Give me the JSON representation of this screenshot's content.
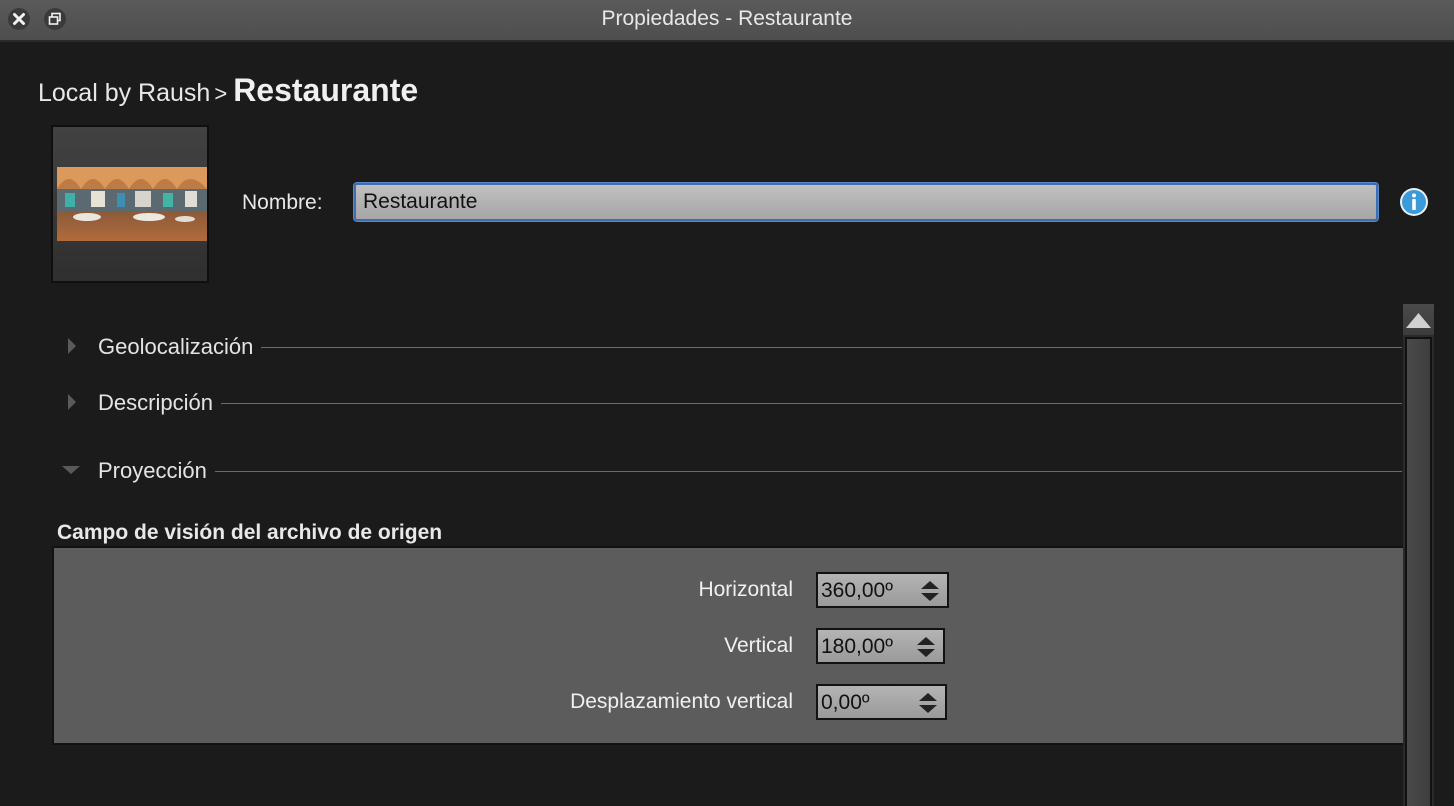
{
  "window": {
    "title": "Propiedades - Restaurante",
    "close_icon": "close-icon",
    "restore_icon": "restore-window-icon"
  },
  "breadcrumb": {
    "parent": "Local by Raush",
    "separator": ">",
    "current": "Restaurante"
  },
  "thumbnail": {
    "description_icon": "panorama-thumbnail"
  },
  "name": {
    "label": "Nombre:",
    "value": "Restaurante",
    "info_icon": "info-icon"
  },
  "sections": [
    {
      "label": "Geolocalización",
      "expanded": false
    },
    {
      "label": "Descripción",
      "expanded": false
    },
    {
      "label": "Proyección",
      "expanded": true
    }
  ],
  "fov": {
    "heading": "Campo de visión del archivo de origen",
    "rows": [
      {
        "label": "Horizontal",
        "value": "360,00º"
      },
      {
        "label": "Vertical",
        "value": "180,00º"
      },
      {
        "label": "Desplazamiento vertical",
        "value": "0,00º"
      }
    ]
  },
  "colors": {
    "background": "#1b1b1b",
    "panel": "#5c5c5c",
    "input_focus": "#3e6fb2",
    "info": "#3b9ad9"
  }
}
